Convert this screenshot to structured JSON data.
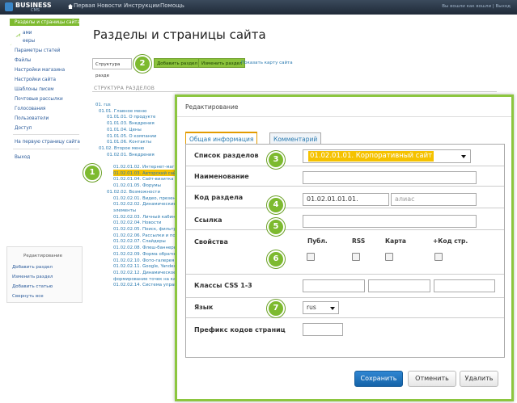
{
  "topbar": {
    "logo": "BUSINESS",
    "logo_sub": "CMS",
    "nav": [
      "Первая",
      "Новости",
      "Инструкции",
      "Помощь"
    ],
    "right": "Вы вошли как вошли | Выход"
  },
  "leftnav": {
    "items": [
      "Разделы и страницы сайта",
      "ами",
      "ееры",
      "Параметры статей",
      "Файлы",
      "Настройки магазина",
      "Настройки сайта",
      "Шаблоны писем",
      "Почтовые рассылки",
      "Голосования",
      "Пользователи",
      "Доступ",
      "На первую страницу сайта",
      "Выход"
    ]
  },
  "main": {
    "title": "Разделы и страницы сайта",
    "structure_select": "Структура разде",
    "buttons": [
      "Добавить раздел",
      "Изменить раздел"
    ],
    "map_link": "Показать карту сайта",
    "section_header": "СТРУКТУРА РАЗДЕЛОВ"
  },
  "tree": [
    "01. rus",
    "01.01. Главное меню",
    "01.01.01. О продукте",
    "01.01.03. Внедрения",
    "01.01.04. Цены",
    "01.01.05. О компании",
    "01.01.06. Контакты",
    "01.02. Второе меню",
    "01.02.01. Внедрения",
    "01.02.01.01. Корпоративный",
    "01.02.01.02. Интернет-магаз",
    "01.02.01.03. Авторский сайт",
    "01.02.01.04. Сайт-визитка",
    "01.02.01.05. Форумы",
    "01.02.02. Возможности",
    "01.02.02.01. Видео, презента",
    "01.02.02.02. Динамические",
    "элементы",
    "01.02.02.03. Личный кабинет",
    "01.02.02.04. Новости",
    "01.02.02.05. Поиск, фильтры",
    "01.02.02.06. Рассылки и подп",
    "01.02.02.07. Слайдеры",
    "01.02.02.08. Флеш-баннеры",
    "01.02.02.09. Форма обратной",
    "01.02.02.10. Фото-галерея",
    "01.02.02.11. Google, Yandex к",
    "01.02.02.12. Динамическое",
    "формирование точек на карте",
    "01.02.02.14. Система управле"
  ],
  "sidebar_box": {
    "title": "Редактирование",
    "items": [
      "Добавить раздел",
      "Изменить раздел",
      "Добавить статью",
      "Свернуть все"
    ]
  },
  "markers": [
    "1",
    "2",
    "3",
    "4",
    "5",
    "6",
    "7"
  ],
  "dialog": {
    "title": "Редактирование",
    "tabs": [
      "Общая информация",
      "Комментарий"
    ],
    "labels": {
      "list": "Список разделов",
      "name": "Наименование",
      "code": "Код раздела",
      "link": "Ссылка",
      "props": "Свойства",
      "css": "Классы CSS 1-3",
      "lang": "Язык",
      "prefix": "Префикс кодов страниц"
    },
    "list_value": "01.02.01.01. Корпоративный сайт",
    "code_value": "01.02.01.01.01.",
    "alias_placeholder": "алиас",
    "props_cols": [
      "Публ.",
      "RSS",
      "Карта",
      "+Код стр."
    ],
    "lang_value": "rus",
    "buttons": {
      "save": "Сохранить",
      "cancel": "Отменить",
      "delete": "Удалить"
    }
  },
  "colors": {
    "accent": "#8cc63f",
    "highlight": "#f5c200",
    "primary": "#1f6fb8"
  }
}
